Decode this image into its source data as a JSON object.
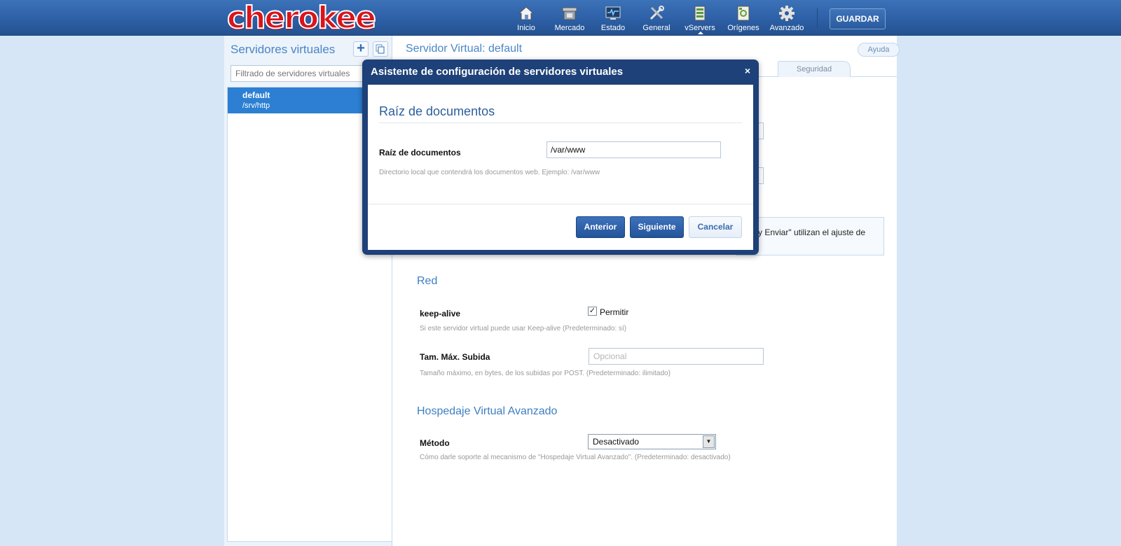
{
  "header": {
    "logo": "cherokee",
    "nav": [
      {
        "label": "Inicio",
        "icon": "home-icon"
      },
      {
        "label": "Mercado",
        "icon": "market-icon"
      },
      {
        "label": "Estado",
        "icon": "status-monitor-icon"
      },
      {
        "label": "General",
        "icon": "tools-icon"
      },
      {
        "label": "vServers",
        "icon": "vservers-icon",
        "active": true
      },
      {
        "label": "Orígenes",
        "icon": "sources-icon"
      },
      {
        "label": "Avanzado",
        "icon": "gear-icon"
      }
    ],
    "save_label": "GUARDAR"
  },
  "sidebar": {
    "title": "Servidores virtuales",
    "add_icon": "plus-icon",
    "clone_icon": "clone-icon",
    "filter_placeholder": "Filtrado de servidores virtuales",
    "items": [
      {
        "name": "default",
        "path": "/srv/http",
        "selected": true
      }
    ]
  },
  "main": {
    "title": "Servidor Virtual: default",
    "help_label": "Ayuda",
    "tabs": [
      {
        "label": "Seguridad"
      }
    ],
    "info_text": "y Enviar\" utilizan el ajuste de",
    "sections": {
      "network": {
        "title": "Red",
        "keepalive_label": "keep-alive",
        "keepalive_checkbox": "Permitir",
        "keepalive_checked": true,
        "keepalive_help": "Si este servidor virtual puede usar Keep-alive (Predeterminado: sí)",
        "upload_label": "Tam. Máx. Subida",
        "upload_placeholder": "Opcional",
        "upload_help": "Tamaño máximo, en bytes, de los subidas por POST. (Predeterminado: ilimitado)"
      },
      "advanced_hosting": {
        "title": "Hospedaje Virtual Avanzado",
        "method_label": "Método",
        "method_value": "Desactivado",
        "method_help": "Cómo darle soporte al mecanismo de \"Hospedaje Virtual Avanzado\". (Predeterminado: desactivado)"
      }
    }
  },
  "modal": {
    "title": "Asistente de configuración de servidores virtuales",
    "close": "×",
    "heading": "Raíz de documentos",
    "field_label": "Raíz de documentos",
    "field_value": "/var/www",
    "field_help": "Directorio local que contendrá los documentos web. Ejemplo: /var/www",
    "buttons": {
      "prev": "Anterior",
      "next": "Siguiente",
      "cancel": "Cancelar"
    }
  },
  "colors": {
    "header_bg": "#2c5ea4",
    "accent": "#4a86c5",
    "modal_bg": "#1d4178",
    "selected_item": "#2c7fd2"
  }
}
